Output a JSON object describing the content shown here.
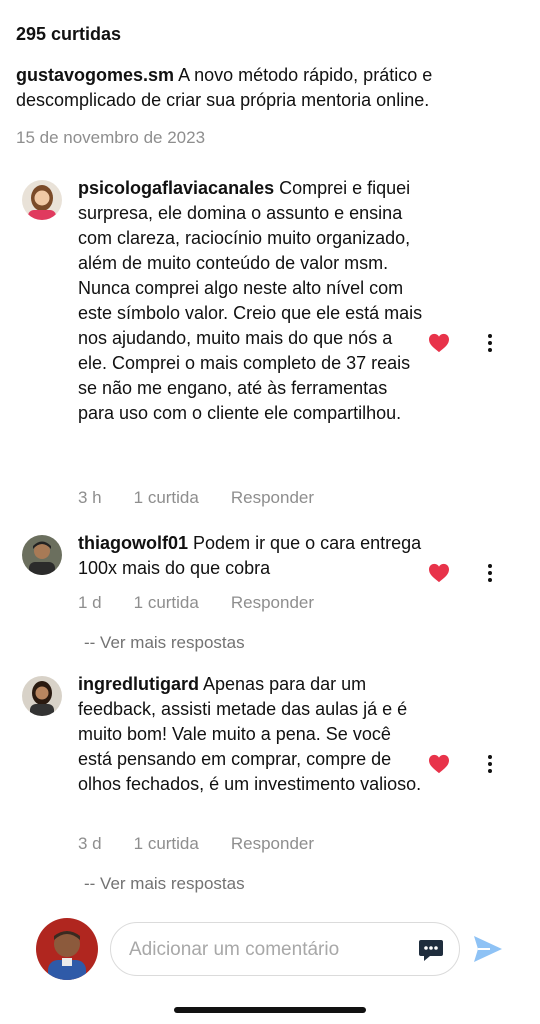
{
  "post": {
    "likes": "295 curtidas",
    "author": "gustavogomes.sm",
    "caption": "A novo método rápido, prático e descomplicado de criar sua própria mentoria online.",
    "date": "15 de novembro de 2023"
  },
  "comments": [
    {
      "username": "psicologaflaviacanales",
      "text": "Comprei e fiquei surpresa, ele domina o assunto e ensina com clareza, raciocínio muito organizado, além de muito conteúdo de valor msm. Nunca comprei algo neste alto nível com este símbolo valor. Creio que ele está mais nos ajudando, muito mais do que nós a ele. Comprei o mais completo de 37 reais se não me engano,  até às ferramentas para uso com o cliente ele compartilhou.",
      "time": "3 h",
      "likes": "1 curtida",
      "reply": "Responder"
    },
    {
      "username": "thiagowolf01",
      "text": "Podem ir que o cara entrega 100x mais do que cobra",
      "time": "1 d",
      "likes": "1 curtida",
      "reply": "Responder",
      "more_replies": "-- Ver mais respostas"
    },
    {
      "username": "ingredlutigard",
      "text": "Apenas para dar um feedback, assisti metade das aulas já e é muito bom! Vale muito a pena. Se você está pensando em comprar, compre de olhos fechados, é um investimento valioso.",
      "time": "3 d",
      "likes": "1 curtida",
      "reply": "Responder",
      "more_replies": "-- Ver mais respostas"
    }
  ],
  "composer": {
    "placeholder": "Adicionar um comentário"
  },
  "icons": {
    "like": "heart-icon",
    "options": "more-options-icon",
    "emoji": "chat-bubble-icon",
    "send": "send-icon"
  },
  "colors": {
    "heart": "#e8334a",
    "send": "#8ec2f5",
    "meta": "#8e8e8e"
  }
}
